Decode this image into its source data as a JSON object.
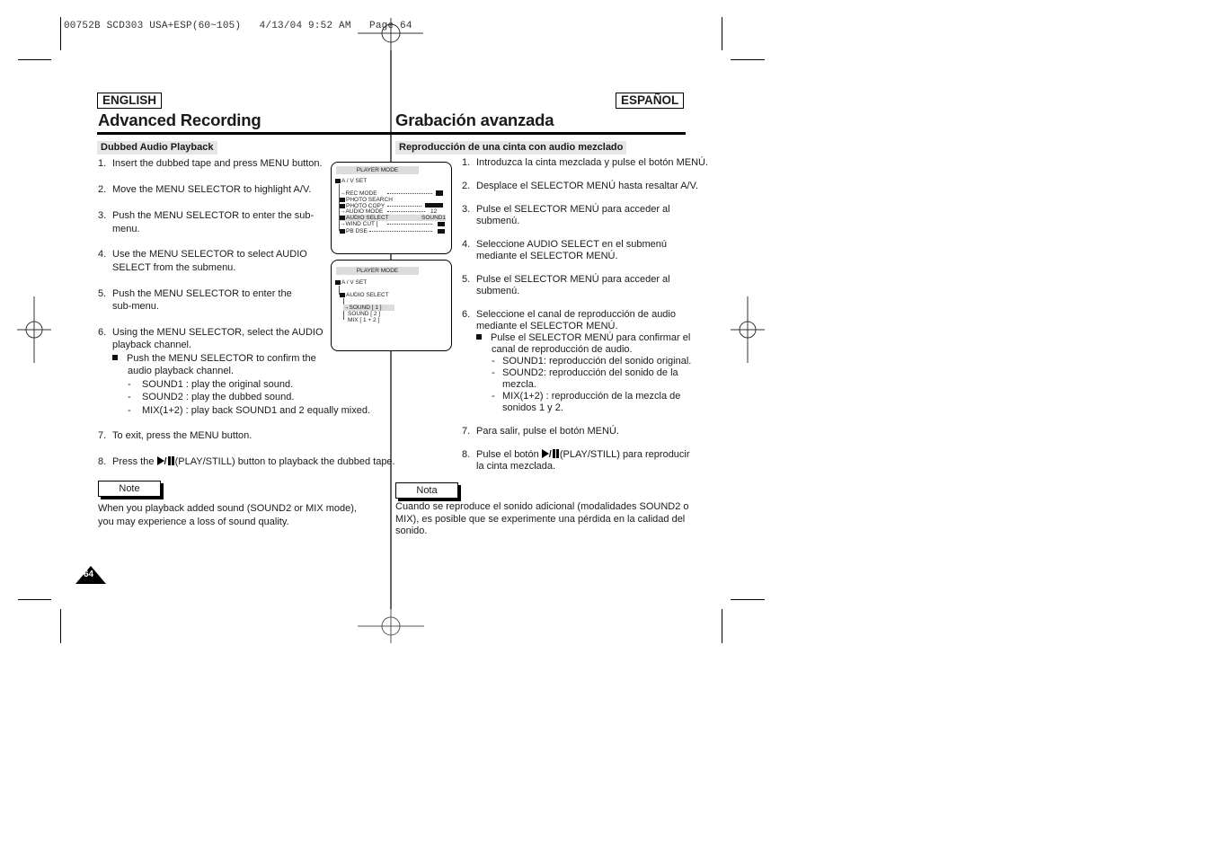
{
  "slug": "00752B SCD303 USA+ESP(60~105)   4/13/04 9:52 AM   Page 64",
  "english": {
    "lang_label": "ENGLISH",
    "title": "Advanced Recording",
    "section": "Dubbed Audio Playback",
    "steps": [
      {
        "n": "1.",
        "lines": [
          "Insert the dubbed tape and press MENU button."
        ]
      },
      {
        "n": "2.",
        "lines": [
          "Move the MENU SELECTOR to highlight A/V."
        ]
      },
      {
        "n": "3.",
        "lines": [
          "Push the MENU SELECTOR to enter the sub-",
          "menu."
        ]
      },
      {
        "n": "4.",
        "lines": [
          "Use the MENU SELECTOR to select AUDIO",
          "SELECT from the submenu."
        ]
      },
      {
        "n": "5.",
        "lines": [
          "Push the MENU SELECTOR to enter the",
          "sub-menu."
        ]
      },
      {
        "n": "6.",
        "lines": [
          "Using the MENU SELECTOR, select the AUDIO",
          "playback channel."
        ]
      },
      {
        "n": "7.",
        "lines": [
          "To exit, press the MENU button."
        ]
      },
      {
        "n": "8.",
        "lines": [
          "Press the",
          "(PLAY/STILL) button to playback the dubbed tape."
        ]
      }
    ],
    "sub_bullet": [
      "Push the MENU SELECTOR to confirm the",
      "audio playback channel."
    ],
    "dash_items": [
      "SOUND1 : play the original sound.",
      "SOUND2 : play the dubbed sound.",
      "MIX(1+2) : play back SOUND1 and 2 equally mixed."
    ],
    "note_label": "Note",
    "note_lines": [
      "When you playback added sound (SOUND2 or MIX mode),",
      "you may experience a loss of sound quality."
    ]
  },
  "espanol": {
    "lang_label": "ESPAÑOL",
    "title": "Grabación avanzada",
    "section": "Reproducción de una cinta con audio mezclado",
    "steps": [
      {
        "n": "1.",
        "lines": [
          "Introduzca la cinta mezclada y pulse el botón MENÚ."
        ]
      },
      {
        "n": "2.",
        "lines": [
          "Desplace el SELECTOR MENÚ hasta resaltar A/V."
        ]
      },
      {
        "n": "3.",
        "lines": [
          "Pulse el SELECTOR MENÚ para acceder al",
          "submenú."
        ]
      },
      {
        "n": "4.",
        "lines": [
          "Seleccione AUDIO SELECT en el submenú",
          "mediante el SELECTOR MENÚ."
        ]
      },
      {
        "n": "5.",
        "lines": [
          "Pulse el SELECTOR MENÚ para acceder al",
          "submenú."
        ]
      },
      {
        "n": "6.",
        "lines": [
          "Seleccione el canal de reproducción de audio",
          "mediante el SELECTOR MENÚ."
        ]
      },
      {
        "n": "7.",
        "lines": [
          "Para salir, pulse el botón MENÚ."
        ]
      },
      {
        "n": "8.",
        "lines": [
          "Pulse el botón",
          "(PLAY/STILL) para reproducir",
          "la cinta mezclada."
        ]
      }
    ],
    "sub_bullet": [
      "Pulse el SELECTOR MENÚ para confirmar el",
      "canal de reproducción de audio."
    ],
    "dash_items": [
      [
        "SOUND1: reproducción del sonido original."
      ],
      [
        "SOUND2: reproducción del sonido de la",
        "mezcla."
      ],
      [
        "MIX(1+2) : reproducción de la mezcla de",
        "sonidos 1 y 2."
      ]
    ],
    "note_label": "Nota",
    "note_lines": [
      "Cuando se reproduce el sonido adicional (modalidades SOUND2 o",
      "MIX), es posible que se experimente una pérdida en la calidad del",
      "sonido."
    ]
  },
  "screen1": {
    "header": "PLAYER MODE",
    "root": "A / V SET",
    "items": [
      {
        "label": "REC MODE",
        "value": ""
      },
      {
        "label": "PHOTO SEARCH",
        "value": ""
      },
      {
        "label": "PHOTO COPY",
        "value": ""
      },
      {
        "label": "AUDIO MODE",
        "value": "12"
      },
      {
        "label": "AUDIO SELECT",
        "value": "SOUND1"
      },
      {
        "label": "WIND CUT",
        "value": ""
      },
      {
        "label": "PB DSE",
        "value": ""
      }
    ]
  },
  "screen2": {
    "header": "PLAYER MODE",
    "root": "A / V SET",
    "sub": "AUDIO SELECT",
    "options": [
      "SOUND [ 1 ]",
      "SOUND [ 2 ]",
      "MIX [ 1 + 2 ]"
    ]
  },
  "page_number": "64"
}
